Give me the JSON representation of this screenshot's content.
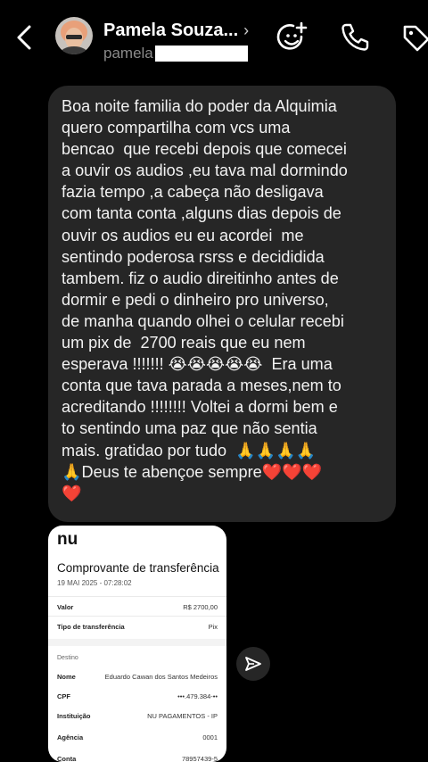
{
  "header": {
    "name": "Pamela Souza...",
    "chevron": "›",
    "username": "pamela",
    "icons": [
      "back-icon",
      "add-emoji-icon",
      "phone-icon",
      "tag-icon"
    ]
  },
  "message": {
    "lines": [
      "Boa noite familia do poder da Alquimia",
      "quero compartilha com vcs uma",
      "bencao  que recebi depois que comecei",
      "a ouvir os audios ,eu tava mal dormindo",
      "fazia tempo ,a cabeça não desligava",
      "com tanta conta ,alguns dias depois de",
      "ouvir os audios eu eu acordei  me",
      "sentindo poderosa rsrss e decididida",
      "tambem. fiz o audio direitinho antes de",
      "dormir e pedi o dinheiro pro universo,",
      "de manha quando olhei o celular recebi",
      "um pix de  2700 reais que eu nem",
      "esperava !!!!!!! 😭😭😭😭😭  Era uma",
      "conta que tava parada a meses,nem to",
      "acreditando !!!!!!!! Voltei a dormi bem e",
      "to sentindo uma paz que não sentia",
      "mais. gratidao por tudo  🙏🙏🙏🙏",
      "🙏Deus te abençoe sempre❤️❤️❤️",
      "❤️"
    ]
  },
  "receipt": {
    "logo": "nu",
    "title": "Comprovante de transferência",
    "date": "19 MAI 2025 - 07:28:02",
    "rows": [
      {
        "label": "Valor",
        "value": "R$ 2700,00"
      },
      {
        "label": "Tipo de transferência",
        "value": "Pix"
      }
    ],
    "destino_label": "Destino",
    "destino_rows": [
      {
        "label": "Nome",
        "value": "Eduardo Cawan dos Santos Medeiros"
      },
      {
        "label": "CPF",
        "value": "•••.479.384-••"
      },
      {
        "label": "Instituição",
        "value": "NU PAGAMENTOS - IP"
      },
      {
        "label": "Agência",
        "value": "0001"
      },
      {
        "label": "Conta",
        "value": "78957439-5"
      }
    ]
  },
  "share": {
    "icon": "send-icon"
  }
}
